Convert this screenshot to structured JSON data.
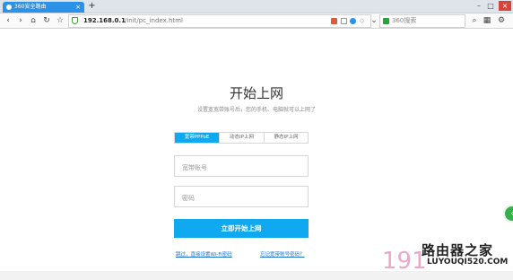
{
  "browser": {
    "tab_title": "360安全路由",
    "tab_close": "×",
    "new_tab": "+",
    "window_controls": {
      "minimize": "–",
      "maximize": "□",
      "close": "×"
    },
    "nav": {
      "back": "‹",
      "forward": "›",
      "home": "⌂",
      "reload": "↻",
      "star": "☆"
    },
    "address_host": "192.168.0.1",
    "address_path": "/init/pc_index.html",
    "search_placeholder": "360搜索",
    "icons": [
      "shield-icon",
      "search-icon",
      "apps-icon",
      "settings-icon"
    ]
  },
  "main": {
    "title": "开始上网",
    "subtitle": "设置宽宽带账号后，您的手机、电脑就可以上网了",
    "tabs": [
      {
        "label": "宽带PPPoE",
        "active": true
      },
      {
        "label": "动态IP上网",
        "active": false
      },
      {
        "label": "静态IP上网",
        "active": false
      }
    ],
    "account_placeholder": "宽带账号",
    "password_placeholder": "密码",
    "connect_button": "立即开始上网",
    "skip_link": "跳过，直接设置Wi-Fi密码",
    "forgot_link": "忘记宽带账号密码？"
  },
  "watermark": {
    "number": "191",
    "cn_text": "路由器之家",
    "url": "LUYOUQI520.COM"
  },
  "colors": {
    "accent": "#10a9ef",
    "tab_blue": "#2b92e8",
    "float_green": "#34b24a"
  }
}
